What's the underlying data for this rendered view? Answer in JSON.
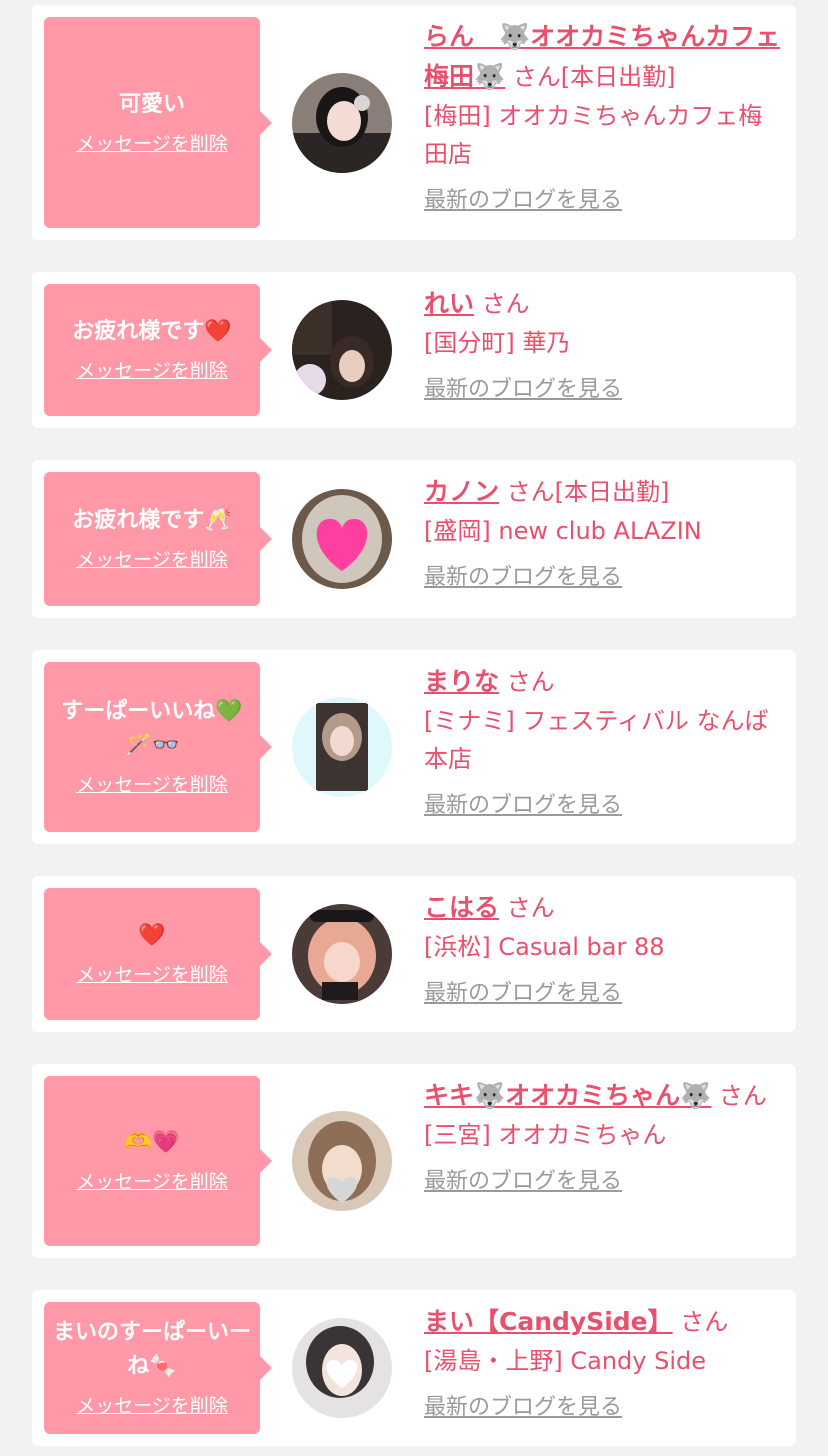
{
  "common": {
    "delete_label": "メッセージを削除",
    "blog_label": "最新のブログを見る",
    "san_label": "さん"
  },
  "cards": [
    {
      "message": "可愛い",
      "name": "らん　🐺オオカミちゃんカフェ梅田🐺",
      "status": "[本日出勤]",
      "shop": "[梅田] オオカミちゃんカフェ梅田店"
    },
    {
      "message": "お疲れ様です❤️",
      "name": "れい",
      "status": "",
      "shop": "[国分町] 華乃"
    },
    {
      "message": "お疲れ様です🥂",
      "name": "カノン",
      "status": "[本日出勤]",
      "shop": "[盛岡] new club ALAZIN"
    },
    {
      "message": "すーぱーいいね💚🪄👓",
      "name": "まりな",
      "status": "",
      "shop": "[ミナミ] フェスティバル なんば本店"
    },
    {
      "message": "❤️",
      "name": "こはる",
      "status": "",
      "shop": "[浜松] Casual bar 88"
    },
    {
      "message": "🫶💗",
      "name": "キキ🐺オオカミちゃん🐺",
      "status": "",
      "shop": "[三宮] オオカミちゃん"
    },
    {
      "message": "まいのすーぱーいーね🍬",
      "name": "まい【CandySide】",
      "status": "",
      "shop": "[湯島・上野] Candy Side"
    }
  ],
  "colors": {
    "bubble": "#ff99a8",
    "accent": "#e8506e",
    "link_gray": "#9a9a9a",
    "background": "#f2f2f4"
  }
}
